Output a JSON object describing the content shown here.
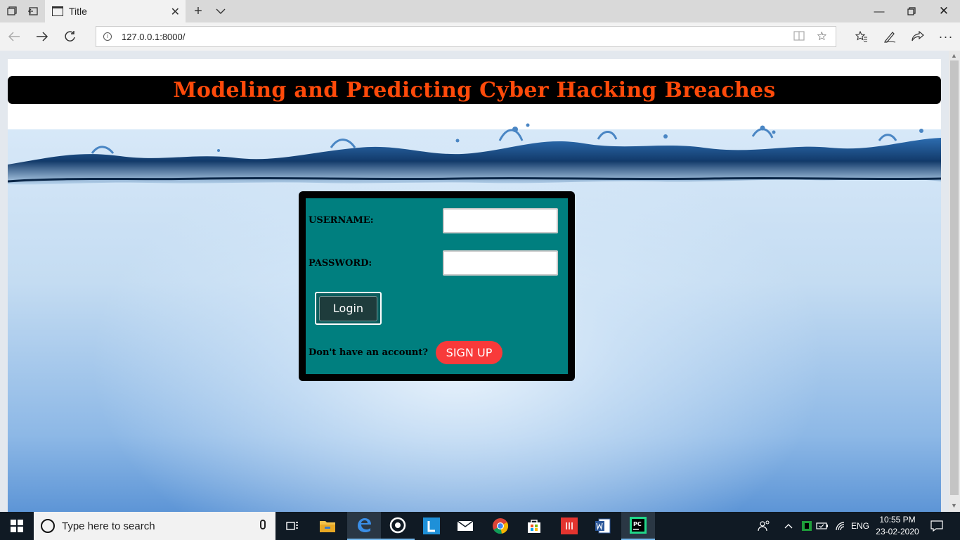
{
  "browser": {
    "tab_title": "Title",
    "url": "127.0.0.1:8000/",
    "icons": [
      "tab-list-icon",
      "set-aside-icon",
      "page-icon",
      "close-tab-icon",
      "new-tab-icon",
      "tab-preview-icon",
      "minimize-icon",
      "restore-icon",
      "close-window-icon",
      "back-icon",
      "forward-icon",
      "refresh-icon",
      "info-icon",
      "reading-view-icon",
      "favorite-star-icon",
      "favorites-icon",
      "pen-icon",
      "share-icon",
      "more-icon"
    ]
  },
  "page": {
    "title": "Modeling and Predicting Cyber Hacking Breaches",
    "username_label": "USERNAME:",
    "password_label": "PASSWORD:",
    "username_value": "",
    "password_value": "",
    "login_label": "Login",
    "signup_prompt": "Don't have an account?",
    "signup_label": "SIGN UP"
  },
  "taskbar": {
    "search_placeholder": "Type here to search",
    "language": "ENG",
    "time": "10:55 PM",
    "date": "23-02-2020"
  },
  "colors": {
    "title_text": "#ff4a0a",
    "card_bg": "#007f7f",
    "signup_bg": "#f83a3a"
  }
}
